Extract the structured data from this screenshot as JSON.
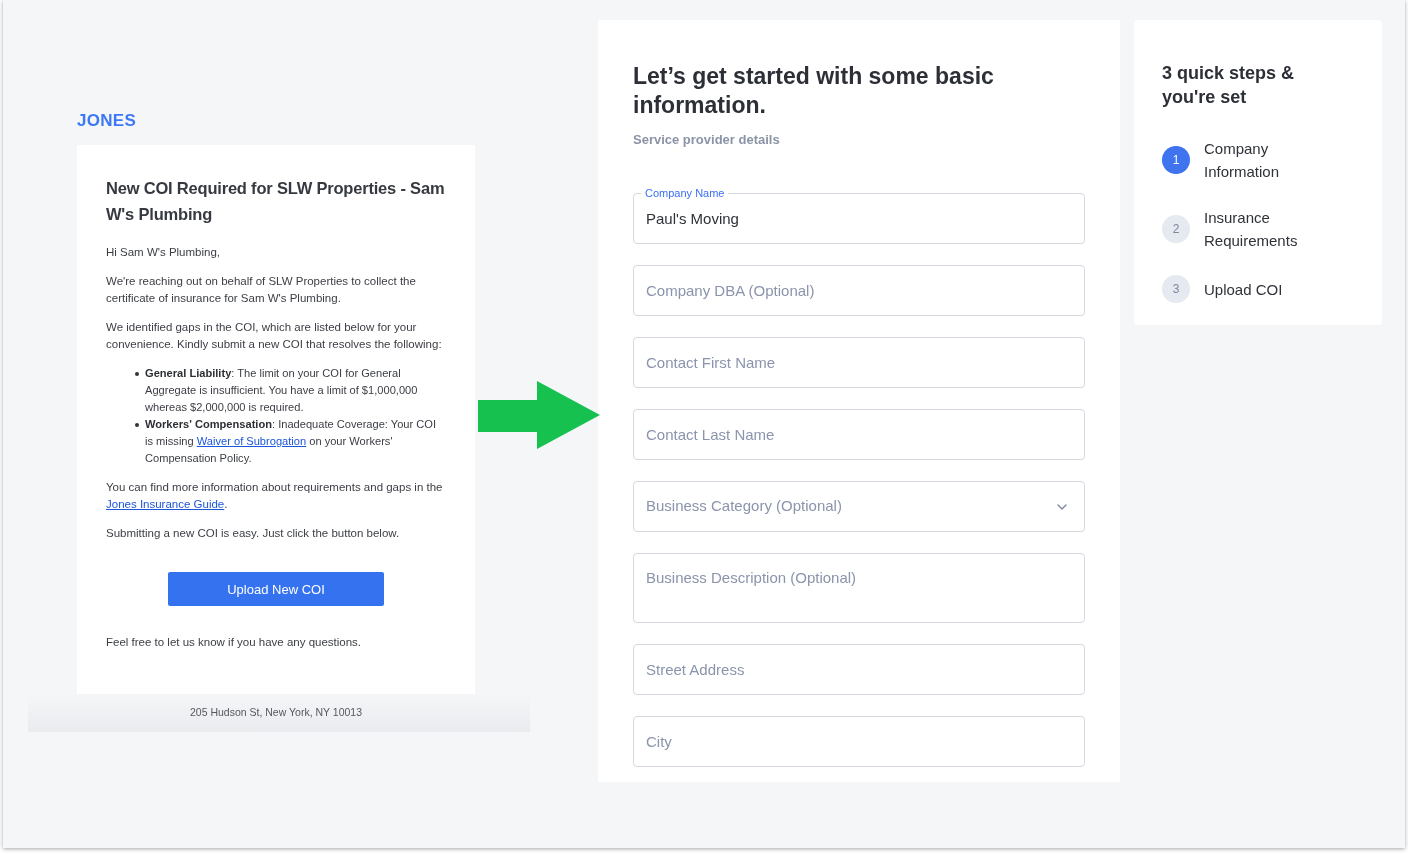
{
  "email": {
    "logo": "JONES",
    "title": "New COI Required for SLW Properties - Sam W's Plumbing",
    "blocks": [
      {
        "kind": "paragraph",
        "segments": [
          {
            "kind": "text",
            "text": "Hi Sam W's Plumbing,"
          }
        ]
      },
      {
        "kind": "paragraph",
        "segments": [
          {
            "kind": "text",
            "text": "We're reaching out on behalf of SLW Properties to collect the certificate of insurance for Sam W's Plumbing."
          }
        ]
      },
      {
        "kind": "paragraph",
        "segments": [
          {
            "kind": "text",
            "text": "We identified gaps in the COI, which are listed below for your convenience. Kindly submit a new COI that resolves the following:"
          }
        ]
      },
      {
        "kind": "list",
        "items": [
          {
            "segments": [
              {
                "kind": "bold",
                "text": "General Liability"
              },
              {
                "kind": "text",
                "text": ": The limit on your COI for General Aggregate is insufficient. You have a limit of $1,000,000 whereas $2,000,000 is required."
              }
            ]
          },
          {
            "segments": [
              {
                "kind": "bold",
                "text": "Workers' Compensation"
              },
              {
                "kind": "text",
                "text": ": Inadequate Coverage: Your COI is missing "
              },
              {
                "kind": "link",
                "text": "Waiver of Subrogation"
              },
              {
                "kind": "text",
                "text": " on your Workers' Compensation Policy."
              }
            ]
          }
        ]
      },
      {
        "kind": "paragraph",
        "segments": [
          {
            "kind": "text",
            "text": "You can find more information about requirements and gaps in the "
          },
          {
            "kind": "link",
            "text": "Jones Insurance Guide"
          },
          {
            "kind": "text",
            "text": "."
          }
        ]
      },
      {
        "kind": "paragraph",
        "segments": [
          {
            "kind": "text",
            "text": "Submitting a new COI is easy. Just click the button below."
          }
        ]
      },
      {
        "kind": "button",
        "label": "Upload New COI"
      },
      {
        "kind": "paragraph",
        "segments": [
          {
            "kind": "text",
            "text": "Feel free to let us know if you have any questions."
          }
        ]
      }
    ],
    "footer": "205 Hudson St, New York, NY 10013"
  },
  "form": {
    "title": "Let’s get started with some basic information.",
    "subtitle": "Service provider details",
    "fields": [
      {
        "kind": "input",
        "label": "Company Name",
        "value": "Paul's Moving"
      },
      {
        "kind": "input",
        "placeholder": "Company DBA (Optional)"
      },
      {
        "kind": "input",
        "placeholder": "Contact First Name"
      },
      {
        "kind": "input",
        "placeholder": "Contact Last Name"
      },
      {
        "kind": "select",
        "placeholder": "Business Category (Optional)"
      },
      {
        "kind": "textarea",
        "placeholder": "Business Description (Optional)"
      },
      {
        "kind": "input",
        "placeholder": "Street Address"
      },
      {
        "kind": "input",
        "placeholder": "City"
      }
    ]
  },
  "steps": {
    "title": "3 quick steps & you're set",
    "items": [
      {
        "number": "1",
        "label": "Company Information",
        "selected": true
      },
      {
        "number": "2",
        "label": "Insurance Requirements",
        "selected": false
      },
      {
        "number": "3",
        "label": "Upload COI",
        "selected": false
      }
    ]
  }
}
